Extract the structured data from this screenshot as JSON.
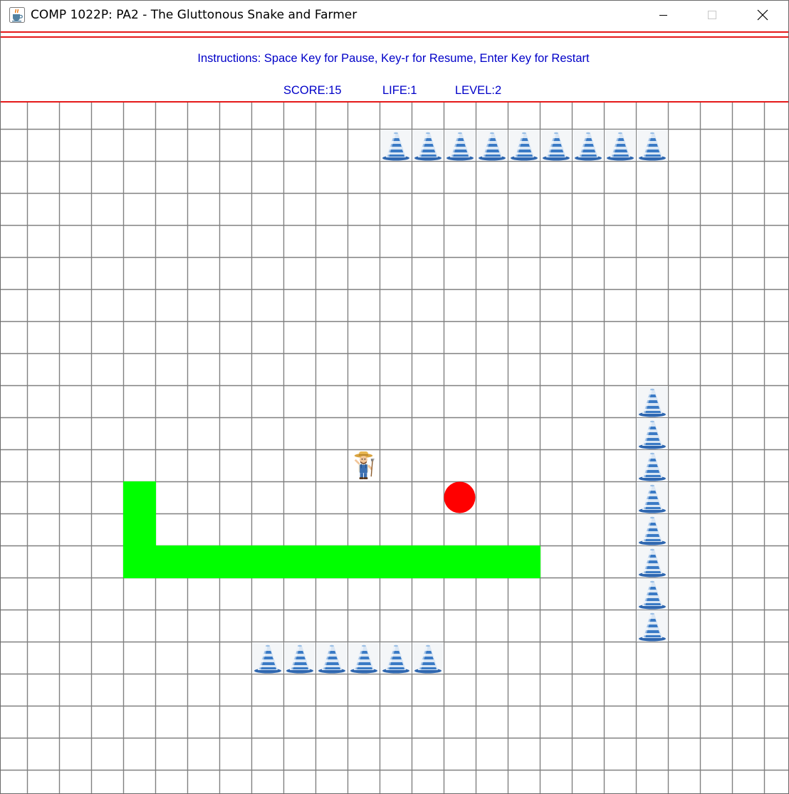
{
  "window": {
    "title": "COMP 1022P: PA2 - The Gluttonous Snake and Farmer",
    "app_icon": "java-cup-icon",
    "controls": [
      "minimize-icon",
      "maximize-icon",
      "close-icon"
    ]
  },
  "header": {
    "instructions": "Instructions: Space Key for Pause, Key-r for Resume, Enter Key for Restart",
    "score_label": "SCORE:15",
    "life_label": "LIFE:1",
    "level_label": "LEVEL:2",
    "score": 15,
    "life": 1,
    "level": 2
  },
  "colors": {
    "text_blue": "#0000c8",
    "divider_red": "#e51919",
    "grid_line": "#808080",
    "snake_green": "#00ff00",
    "food_red": "#ff0000"
  },
  "board": {
    "cell_icons": {
      "obstacle": "traffic-cone-icon",
      "farmer": "farmer-icon",
      "food": "red-dot"
    },
    "obstacles": [
      [
        12,
        1
      ],
      [
        13,
        1
      ],
      [
        14,
        1
      ],
      [
        15,
        1
      ],
      [
        16,
        1
      ],
      [
        17,
        1
      ],
      [
        18,
        1
      ],
      [
        19,
        1
      ],
      [
        20,
        1
      ],
      [
        20,
        9
      ],
      [
        20,
        10
      ],
      [
        20,
        11
      ],
      [
        20,
        12
      ],
      [
        20,
        13
      ],
      [
        20,
        14
      ],
      [
        20,
        15
      ],
      [
        20,
        16
      ],
      [
        8,
        17
      ],
      [
        9,
        17
      ],
      [
        10,
        17
      ],
      [
        11,
        17
      ],
      [
        12,
        17
      ],
      [
        13,
        17
      ]
    ],
    "snake": [
      [
        4,
        12
      ],
      [
        4,
        13
      ],
      [
        4,
        14
      ],
      [
        5,
        14
      ],
      [
        6,
        14
      ],
      [
        7,
        14
      ],
      [
        8,
        14
      ],
      [
        9,
        14
      ],
      [
        10,
        14
      ],
      [
        11,
        14
      ],
      [
        12,
        14
      ],
      [
        13,
        14
      ],
      [
        14,
        14
      ],
      [
        15,
        14
      ],
      [
        16,
        14
      ]
    ],
    "food": [
      14,
      12
    ],
    "farmer": [
      11,
      11
    ]
  }
}
